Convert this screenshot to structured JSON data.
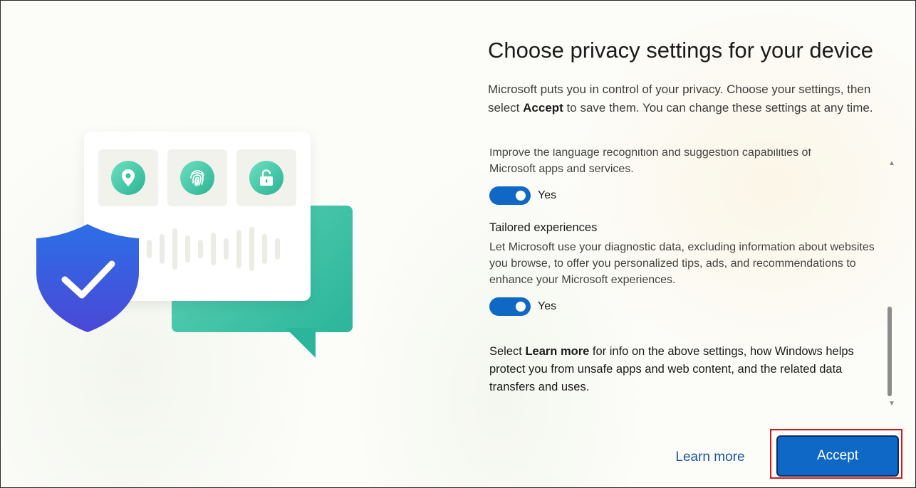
{
  "page": {
    "title": "Choose privacy settings for your device",
    "intro_part1": "Microsoft puts you in control of your privacy. Choose your settings, then select ",
    "intro_bold": "Accept",
    "intro_part2": " to save them. You can change these settings at any time."
  },
  "settings": {
    "inking": {
      "desc_cut": "Improve the language recognition and suggestion capabilities of",
      "desc_line2": "Microsoft apps and services.",
      "toggle_label": "Yes",
      "enabled": true
    },
    "tailored": {
      "title": "Tailored experiences",
      "desc": "Let Microsoft use your diagnostic data, excluding information about websites you browse, to offer you personalized tips, ads, and recommendations to enhance your Microsoft experiences.",
      "toggle_label": "Yes",
      "enabled": true
    },
    "learn_info": {
      "prefix": "Select ",
      "bold": "Learn more",
      "suffix": " for info on the above settings, how Windows helps protect you from unsafe apps and web content, and the related data transfers and uses."
    }
  },
  "buttons": {
    "learn_more": "Learn more",
    "accept": "Accept"
  },
  "icons": {
    "location": "location-pin-icon",
    "fingerprint": "fingerprint-icon",
    "lock": "unlock-icon",
    "shield": "shield-check-icon"
  },
  "colors": {
    "accent": "#0f67c6",
    "highlight": "#d01b1b",
    "teal": "#2bb59a",
    "shield": "#3b63e0"
  }
}
